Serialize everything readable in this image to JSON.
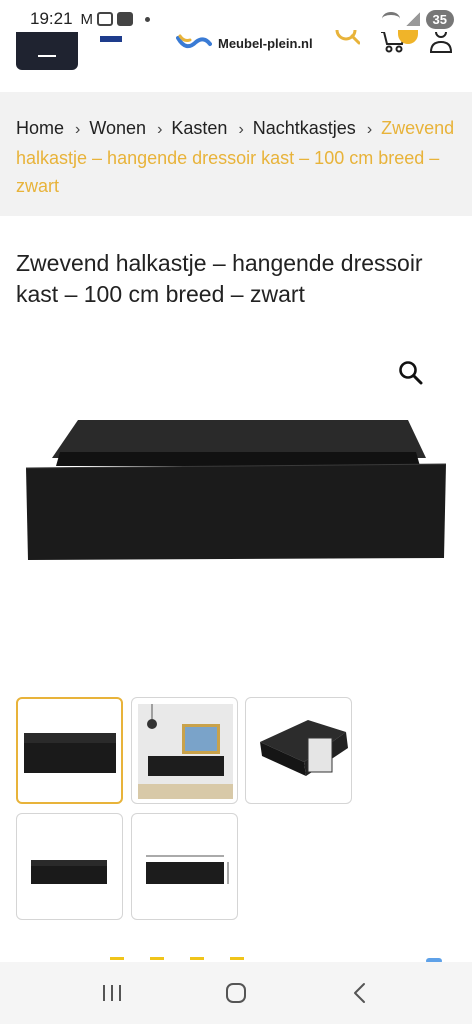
{
  "status_bar": {
    "time": "19:21",
    "battery": "35"
  },
  "header": {
    "logo_text": "Meubel-plein.nl"
  },
  "breadcrumb": {
    "items": [
      "Home",
      "Wonen",
      "Kasten",
      "Nachtkastjes"
    ],
    "current": "Zwevend halkastje – hangende dressoir kast – 100 cm breed – zwart"
  },
  "product": {
    "title": "Zwevend halkastje – hangende dressoir kast – 100 cm breed – zwart"
  },
  "colors": {
    "accent": "#e8b33a",
    "menu_bg": "#1f2330",
    "breadcrumb_bg": "#f2f2f2"
  },
  "icons": {
    "search": "search-icon",
    "cart": "cart-icon",
    "user": "user-icon",
    "zoom": "zoom-icon",
    "menu": "hamburger-icon"
  }
}
